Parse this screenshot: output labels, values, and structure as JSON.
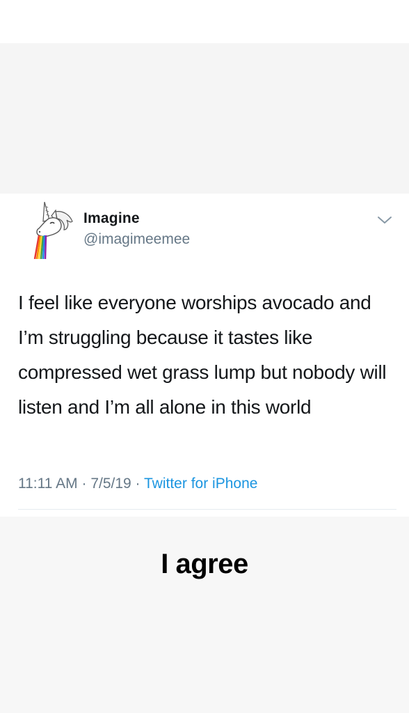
{
  "tweet": {
    "display_name": "Imagine",
    "handle": "@imagimeemee",
    "text": "I feel like everyone worships avocado and I’m struggling because it tastes like compressed wet grass lump but nobody will listen and I’m all alone in this world",
    "time": "11:11 AM",
    "separator": "·",
    "date": "7/5/19",
    "source": "Twitter for iPhone",
    "avatar_icon": "unicorn-rainbow-icon",
    "menu_icon": "chevron-down-icon"
  },
  "caption": {
    "text": "I agree"
  },
  "colors": {
    "background": "#f7f7f7",
    "card": "#ffffff",
    "text_primary": "#14171a",
    "text_secondary": "#657786",
    "link": "#1b95e0",
    "caption": "#000000"
  }
}
